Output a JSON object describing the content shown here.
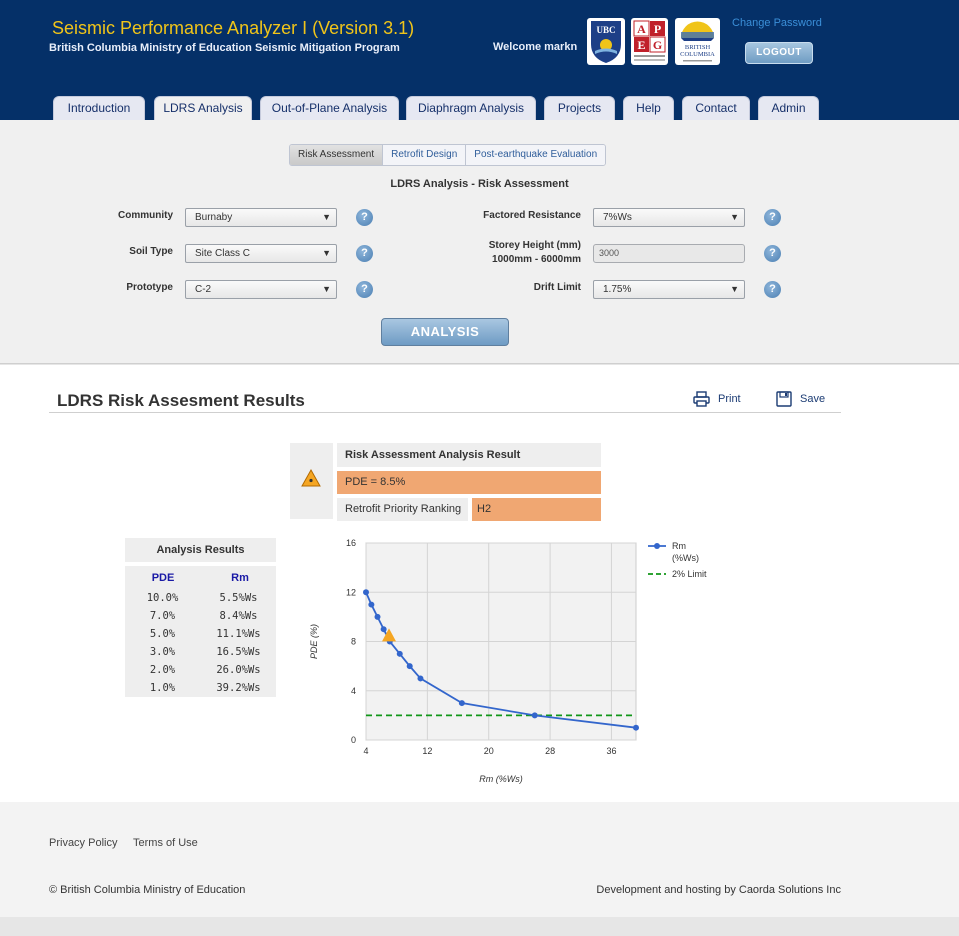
{
  "header": {
    "title": "Seismic Performance Analyzer I (Version 3.1)",
    "subtitle": "British Columbia Ministry of Education Seismic Mitigation Program",
    "welcome": "Welcome markn",
    "change_password": "Change Password",
    "logout": "LOGOUT",
    "logos": {
      "ubc": "UBC",
      "apeg_letters": [
        "A",
        "P",
        "E",
        "G"
      ],
      "bc_line1": "BRITISH",
      "bc_line2": "COLUMBIA"
    }
  },
  "nav_tabs": [
    {
      "label": "Introduction"
    },
    {
      "label": "LDRS Analysis",
      "active": true
    },
    {
      "label": "Out-of-Plane Analysis"
    },
    {
      "label": "Diaphragm Analysis"
    },
    {
      "label": "Projects"
    },
    {
      "label": "Help"
    },
    {
      "label": "Contact"
    },
    {
      "label": "Admin"
    }
  ],
  "sub_tabs": [
    {
      "label": "Risk Assessment",
      "active": true
    },
    {
      "label": "Retrofit Design"
    },
    {
      "label": "Post-earthquake Evaluation"
    }
  ],
  "form": {
    "title": "LDRS Analysis - Risk Assessment",
    "community": {
      "label": "Community",
      "value": "Burnaby"
    },
    "soil_type": {
      "label": "Soil Type",
      "value": "Site Class C"
    },
    "prototype": {
      "label": "Prototype",
      "value": "C-2"
    },
    "factored_resistance": {
      "label": "Factored Resistance",
      "value": "7%Ws"
    },
    "storey_height": {
      "label_line1": "Storey Height (mm)",
      "label_line2": "1000mm - 6000mm",
      "value": "3000"
    },
    "drift_limit": {
      "label": "Drift Limit",
      "value": "1.75%"
    },
    "help_glyph": "?",
    "analysis_button": "ANALYSIS"
  },
  "results": {
    "title": "LDRS Risk Assesment Results",
    "print": "Print",
    "save": "Save",
    "analysis_header": "Risk Assessment Analysis Result",
    "pde": "PDE = 8.5%",
    "rank_label": "Retrofit Priority Ranking",
    "rank_value": "H2",
    "table": {
      "title": "Analysis Results",
      "col_pde": "PDE",
      "col_rm": "Rm",
      "rows": [
        {
          "pde": "10.0%",
          "rm": "5.5%Ws"
        },
        {
          "pde": "7.0%",
          "rm": "8.4%Ws"
        },
        {
          "pde": "5.0%",
          "rm": "11.1%Ws"
        },
        {
          "pde": "3.0%",
          "rm": "16.5%Ws"
        },
        {
          "pde": "2.0%",
          "rm": "26.0%Ws"
        },
        {
          "pde": "1.0%",
          "rm": "39.2%Ws"
        }
      ]
    }
  },
  "chart_data": {
    "type": "line",
    "xlabel": "Rm (%Ws)",
    "ylabel": "PDE (%)",
    "xlim": [
      4,
      39.2
    ],
    "ylim": [
      0,
      16
    ],
    "xticks": [
      4,
      12,
      20,
      28,
      36
    ],
    "yticks": [
      0,
      4,
      8,
      12,
      16
    ],
    "grid": true,
    "legend_position": "right",
    "series": [
      {
        "name": "Rm (%Ws)",
        "color": "#3366cc",
        "x": [
          4.0,
          4.7,
          5.5,
          6.3,
          7.1,
          8.4,
          9.7,
          11.1,
          16.5,
          26.0,
          39.2
        ],
        "y": [
          12.0,
          11.0,
          10.0,
          9.0,
          8.0,
          7.0,
          6.0,
          5.0,
          3.0,
          2.0,
          1.0
        ]
      },
      {
        "name": "2% Limit",
        "color": "#109618",
        "dashed": true,
        "x": [
          4,
          39.2
        ],
        "y": [
          2,
          2
        ]
      }
    ],
    "marker": {
      "x": 7.0,
      "y": 8.5,
      "shape": "triangle",
      "color": "#f5a623"
    }
  },
  "footer": {
    "privacy": "Privacy Policy",
    "terms": "Terms of Use",
    "copyright": "© British Columbia Ministry of Education",
    "hosting": "Development and hosting by Caorda Solutions Inc"
  }
}
